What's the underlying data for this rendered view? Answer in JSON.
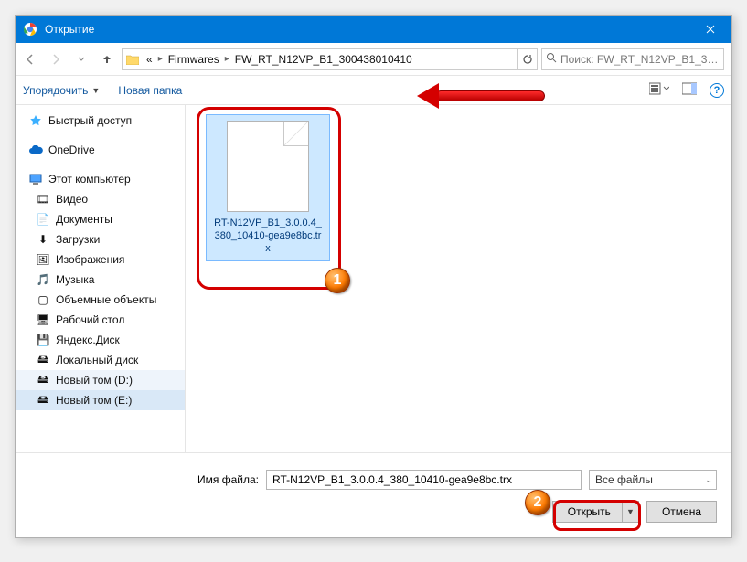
{
  "titlebar": {
    "title": "Открытие"
  },
  "breadcrumb": {
    "segs": [
      "«",
      "Firmwares",
      "FW_RT_N12VP_B1_300438010410"
    ]
  },
  "search": {
    "placeholder": "Поиск: FW_RT_N12VP_B1_300..."
  },
  "toolbar": {
    "organize": "Упорядочить",
    "newfolder": "Новая папка"
  },
  "nav": {
    "quick": "Быстрый доступ",
    "onedrive": "OneDrive",
    "pc": "Этот компьютер",
    "children": [
      "Видео",
      "Документы",
      "Загрузки",
      "Изображения",
      "Музыка",
      "Объемные объекты",
      "Рабочий стол",
      "Яндекс.Диск",
      "Локальный диск",
      "Новый том (D:)",
      "Новый том (E:)"
    ]
  },
  "file": {
    "name": "RT-N12VP_B1_3.0.0.4_380_10410-gea9e8bc.trx"
  },
  "footer": {
    "label": "Имя файла:",
    "value": "RT-N12VP_B1_3.0.0.4_380_10410-gea9e8bc.trx",
    "filter": "Все файлы",
    "open": "Открыть",
    "cancel": "Отмена"
  },
  "balloons": {
    "one": "1",
    "two": "2"
  }
}
